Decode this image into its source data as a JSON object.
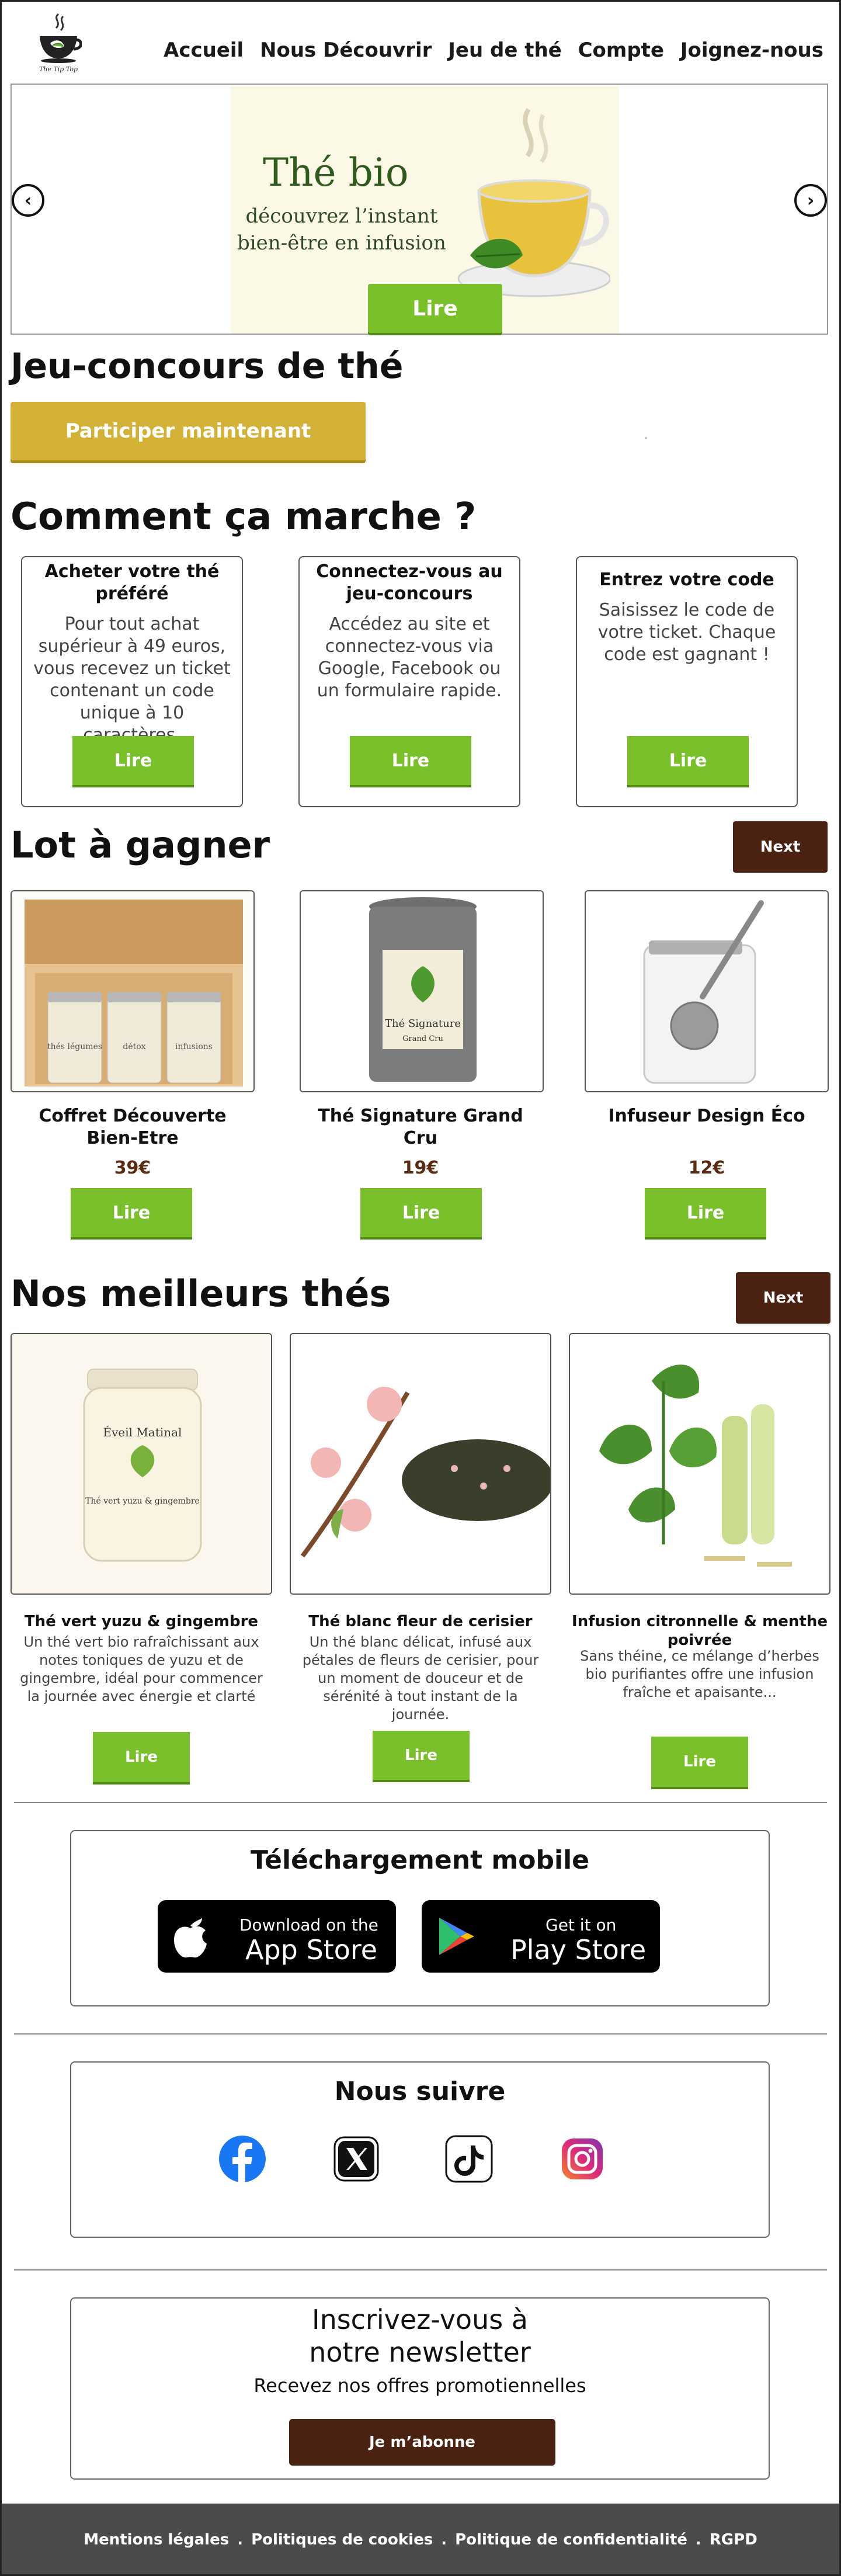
{
  "brand": {
    "name": "The Tip Top"
  },
  "nav": {
    "items": [
      "Accueil",
      "Nous Découvrir",
      "Jeu de thé",
      "Compte",
      "Joignez-nous"
    ]
  },
  "hero": {
    "title": "Thé bio",
    "subtitle": "découvrez l’instant bien-être en infusion",
    "button": "Lire",
    "prev_icon": "chevron-left-icon",
    "next_icon": "chevron-right-icon"
  },
  "contest": {
    "title": "Jeu-concours de thé",
    "participate": "Participer maintenant"
  },
  "how": {
    "title": "Comment ça marche ?",
    "steps": [
      {
        "title": "Acheter votre thé préféré",
        "text": "Pour tout achat supérieur à 49 euros, vous recevez un ticket contenant un code unique à 10 caractères.",
        "button": "Lire"
      },
      {
        "title": "Connectez-vous au jeu-concours",
        "text": "Accédez au site et connectez-vous via Google, Facebook ou un formulaire rapide.",
        "button": "Lire"
      },
      {
        "title": "Entrez votre code",
        "text": "Saisissez le code de votre ticket. Chaque code est gagnant !",
        "button": "Lire"
      }
    ]
  },
  "lots": {
    "title": "Lot à gagner",
    "next": "Next",
    "items": [
      {
        "name": "Coffret Découverte Bien-Etre",
        "price": "39€",
        "button": "Lire",
        "labels": [
          "thés légumes",
          "détox",
          "infusions"
        ]
      },
      {
        "name": "Thé Signature Grand Cru",
        "price": "19€",
        "button": "Lire",
        "label": "Thé Signature",
        "sublabel": "Grand Cru"
      },
      {
        "name": "Infuseur Design Éco",
        "price": "12€",
        "button": "Lire"
      }
    ]
  },
  "teas": {
    "title": "Nos meilleurs thés",
    "next": "Next",
    "items": [
      {
        "name": "Thé vert yuzu & gingembre",
        "desc": "Un thé vert bio rafraîchissant aux notes toniques de yuzu et de gingembre, idéal pour commencer la journée avec énergie et clarté",
        "button": "Lire",
        "jar_label": "Éveil Matinal",
        "jar_sub": "Thé vert yuzu & gingembre"
      },
      {
        "name": "Thé blanc fleur de cerisier",
        "desc": "Un thé blanc délicat, infusé aux pétales de fleurs de cerisier, pour un moment de douceur et de sérénité à tout instant de la journée.",
        "button": "Lire"
      },
      {
        "name": "Infusion citronnelle & menthe poivrée",
        "desc": "Sans théine, ce mélange d’herbes bio purifiantes offre une infusion fraîche et apaisante...",
        "button": "Lire"
      }
    ]
  },
  "mobile": {
    "title": "Téléchargement mobile",
    "appstore_small": "Download on the",
    "appstore_big": "App Store",
    "playstore_small": "Get it on",
    "playstore_big": "Play Store"
  },
  "follow": {
    "title": "Nous suivre",
    "icons": [
      "facebook-icon",
      "x-icon",
      "tiktok-icon",
      "instagram-icon"
    ]
  },
  "newsletter": {
    "title": "Inscrivez-vous à notre newsletter",
    "subtitle": "Recevez nos offres promotiennelles",
    "button": "Je m’abonne"
  },
  "footer": {
    "links": [
      "Mentions légales",
      "Politiques de cookies",
      "Politique de confidentialité",
      "RGPD"
    ],
    "separator": "."
  },
  "colors": {
    "green": "#79c02a",
    "brown": "#4b2212",
    "gold": "#d2b136",
    "footer": "#4b4b4b"
  }
}
